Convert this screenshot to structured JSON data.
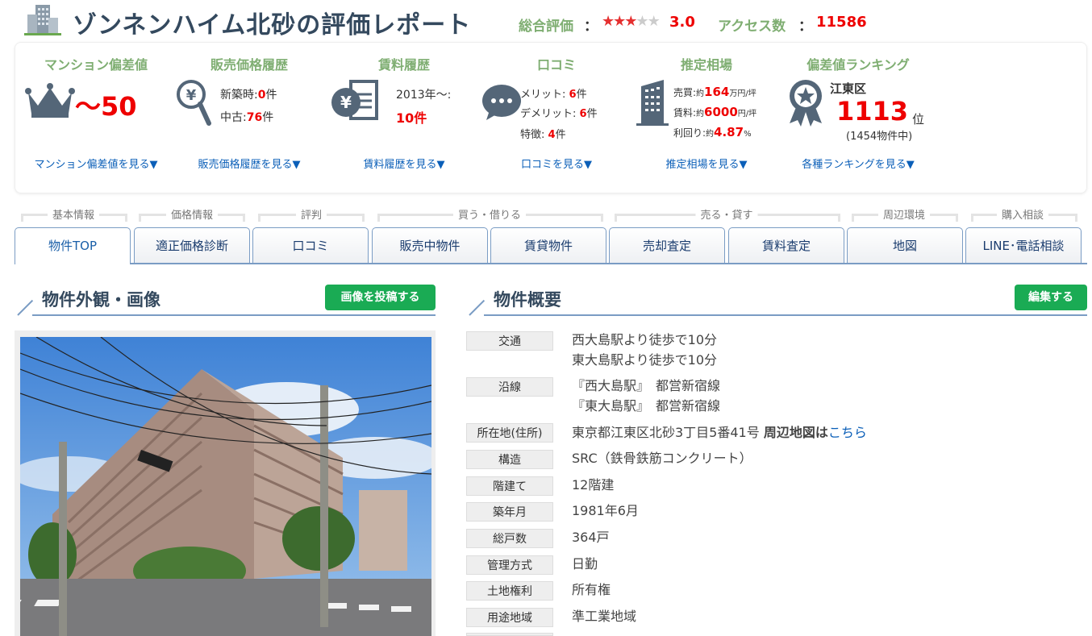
{
  "header": {
    "title": "ゾンネンハイム北砂の評価レポート",
    "rating_label": "総合評価",
    "colon": "：",
    "rating_stars": 3,
    "rating_value": "3.0",
    "access_label": "アクセス数",
    "access_value": "11586"
  },
  "summary": {
    "deviation": {
      "title": "マンション偏差値",
      "value": "～50",
      "link": "マンション偏差値を見る▼"
    },
    "sales_history": {
      "title": "販売価格履歴",
      "new_label": "新築時:",
      "new_count": "0",
      "used_label": "中古:",
      "used_count": "76",
      "unit": "件",
      "link": "販売価格履歴を見る▼"
    },
    "rent_history": {
      "title": "賃料履歴",
      "since": "2013年～:",
      "count": "10件",
      "link": "賃料履歴を見る▼"
    },
    "reviews": {
      "title": "口コミ",
      "merit_label": "メリット:",
      "merit": "6",
      "demerit_label": "デメリット:",
      "demerit": "6",
      "feature_label": "特徴:",
      "feature": "4",
      "unit": "件",
      "link": "口コミを見る▼"
    },
    "market": {
      "title": "推定相場",
      "sale_label": "売買:",
      "sale_prefix": "約",
      "sale_value": "164",
      "sale_unit": "万円/坪",
      "rent_label": "賃料:",
      "rent_prefix": "約",
      "rent_value": "6000",
      "rent_unit": "円/坪",
      "yield_label": "利回り:",
      "yield_prefix": "約",
      "yield_value": "4.87",
      "yield_unit": "%",
      "link": "推定相場を見る▼"
    },
    "ranking": {
      "title": "偏差値ランキング",
      "area": "江東区",
      "rank": "1113",
      "rank_unit": "位",
      "total": "(1454物件中)",
      "link": "各種ランキングを見る▼"
    }
  },
  "tab_categories": [
    "基本情報",
    "価格情報",
    "評判",
    "買う・借りる",
    "売る・貸す",
    "周辺環境",
    "購入相談"
  ],
  "tabs": [
    "物件TOP",
    "適正価格診断",
    "口コミ",
    "販売中物件",
    "賃貸物件",
    "売却査定",
    "賃料査定",
    "地図",
    "LINE･電話相談"
  ],
  "photo_section": {
    "title": "物件外観・画像",
    "button": "画像を投稿する"
  },
  "overview": {
    "title": "物件概要",
    "button": "編集する",
    "rows": [
      {
        "label": "交通",
        "lines": [
          "西大島駅より徒歩で10分",
          "東大島駅より徒歩で10分"
        ]
      },
      {
        "label": "沿線",
        "lines": [
          "『西大島駅』　都営新宿線",
          "『東大島駅』　都営新宿線"
        ]
      },
      {
        "label": "所在地(住所)",
        "value": "東京都江東区北砂3丁目5番41号",
        "extra_bold": "周辺地図は",
        "extra_link": "こちら"
      },
      {
        "label": "構造",
        "value": "SRC（鉄骨鉄筋コンクリート）"
      },
      {
        "label": "階建て",
        "value": "12階建"
      },
      {
        "label": "築年月",
        "value": "1981年6月"
      },
      {
        "label": "総戸数",
        "value": "364戸"
      },
      {
        "label": "管理方式",
        "value": "日勤"
      },
      {
        "label": "土地権利",
        "value": "所有権"
      },
      {
        "label": "用途地域",
        "value": "準工業地域"
      }
    ]
  },
  "colors": {
    "accent_green": "#7fae72",
    "brand_blue": "#34495e",
    "red": "#e00000",
    "button_green": "#1aab54",
    "link_blue": "#0b5fb8"
  }
}
